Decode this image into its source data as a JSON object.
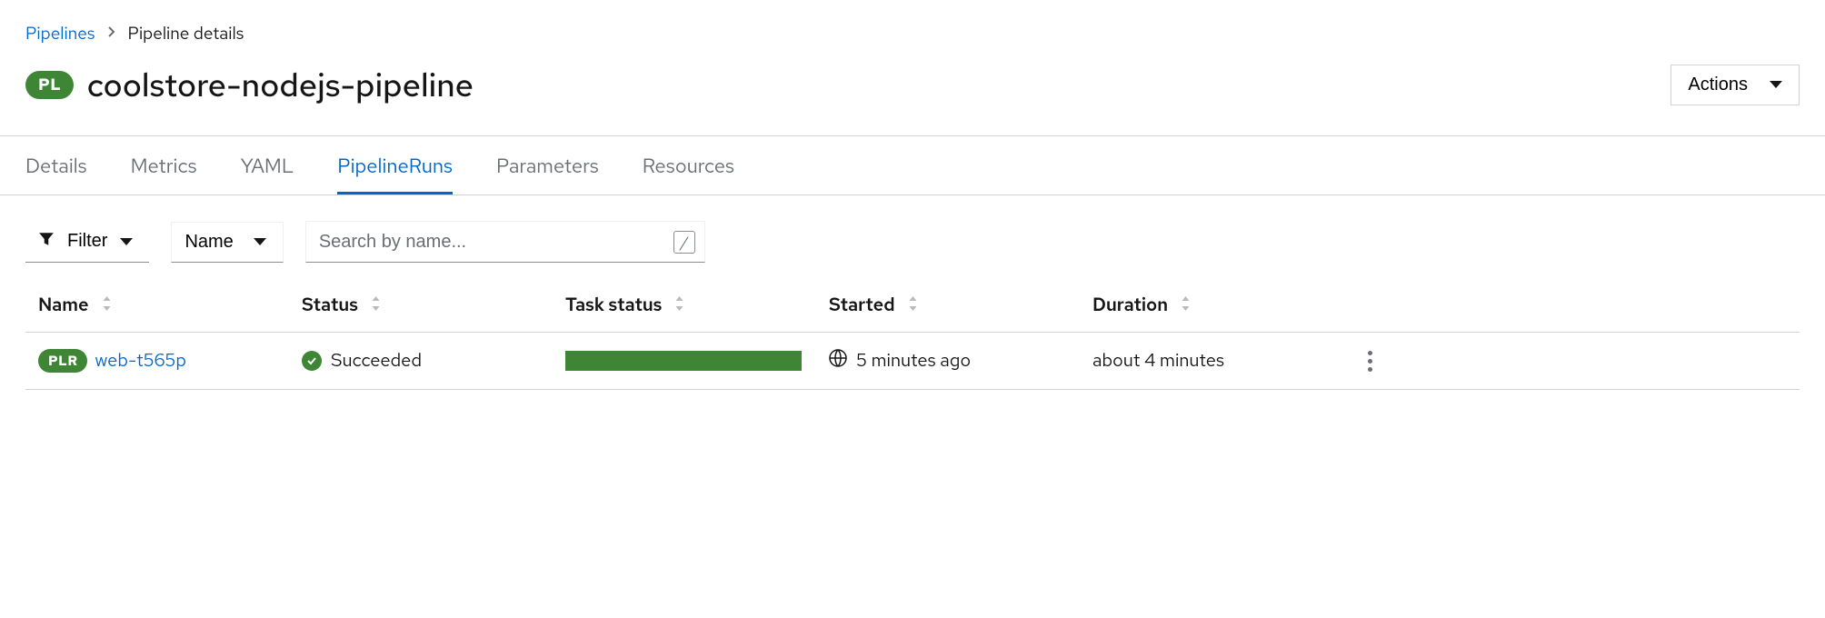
{
  "breadcrumb": {
    "parent": "Pipelines",
    "current": "Pipeline details"
  },
  "title": {
    "badge": "PL",
    "text": "coolstore-nodejs-pipeline"
  },
  "actions_label": "Actions",
  "tabs": [
    {
      "label": "Details",
      "active": false
    },
    {
      "label": "Metrics",
      "active": false
    },
    {
      "label": "YAML",
      "active": false
    },
    {
      "label": "PipelineRuns",
      "active": true
    },
    {
      "label": "Parameters",
      "active": false
    },
    {
      "label": "Resources",
      "active": false
    }
  ],
  "toolbar": {
    "filter_label": "Filter",
    "name_selector": "Name",
    "search_placeholder": "Search by name...",
    "kbd_hint": "/"
  },
  "columns": {
    "name": "Name",
    "status": "Status",
    "task_status": "Task status",
    "started": "Started",
    "duration": "Duration"
  },
  "rows": [
    {
      "badge": "PLR",
      "name": "web-t565p",
      "status": "Succeeded",
      "started": "5 minutes ago",
      "duration": "about 4 minutes"
    }
  ],
  "colors": {
    "link": "#0066cc",
    "success": "#3e8635"
  }
}
